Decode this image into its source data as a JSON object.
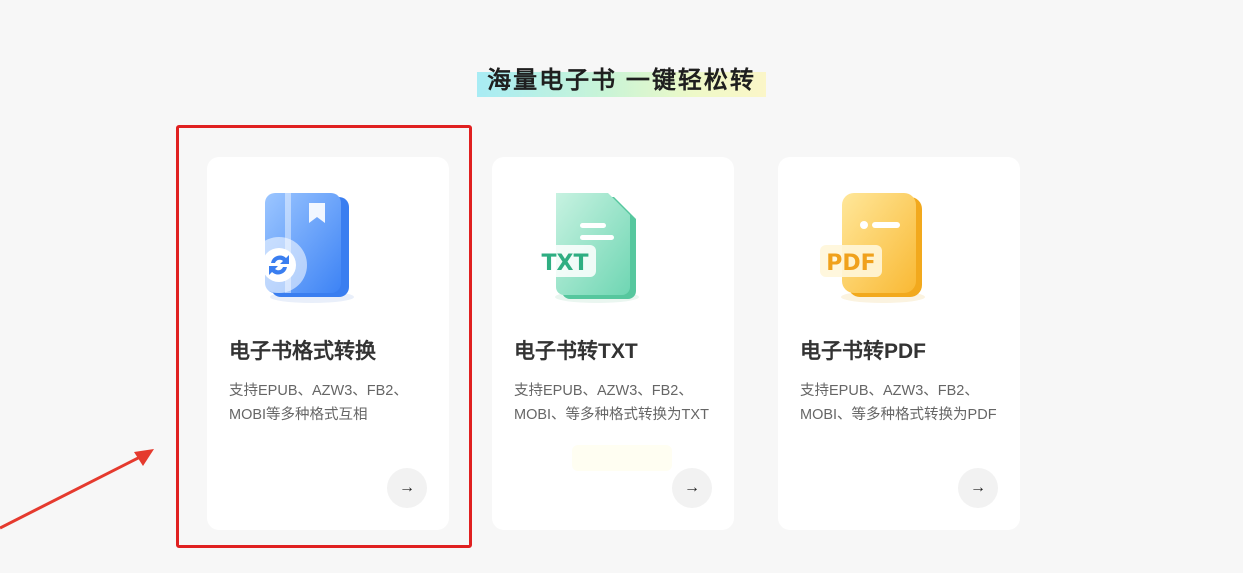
{
  "header": {
    "title": "海量电子书 一键轻松转"
  },
  "cards": [
    {
      "title": "电子书格式转换",
      "description": "支持EPUB、AZW3、FB2、MOBI等多种格式互相",
      "icon": "ebook-convert-icon",
      "icon_label": "",
      "accent": "#5b9bf8"
    },
    {
      "title": "电子书转TXT",
      "description": "支持EPUB、AZW3、FB2、MOBI、等多种格式转换为TXT",
      "icon": "txt-file-icon",
      "icon_label": "TXT",
      "accent": "#6fd6b3"
    },
    {
      "title": "电子书转PDF",
      "description": "支持EPUB、AZW3、FB2、MOBI、等多种格式转换为PDF",
      "icon": "pdf-file-icon",
      "icon_label": "PDF",
      "accent": "#fcc94e"
    }
  ],
  "arrow_symbol": "→",
  "annotation": {
    "highlight_color": "#e02020"
  }
}
